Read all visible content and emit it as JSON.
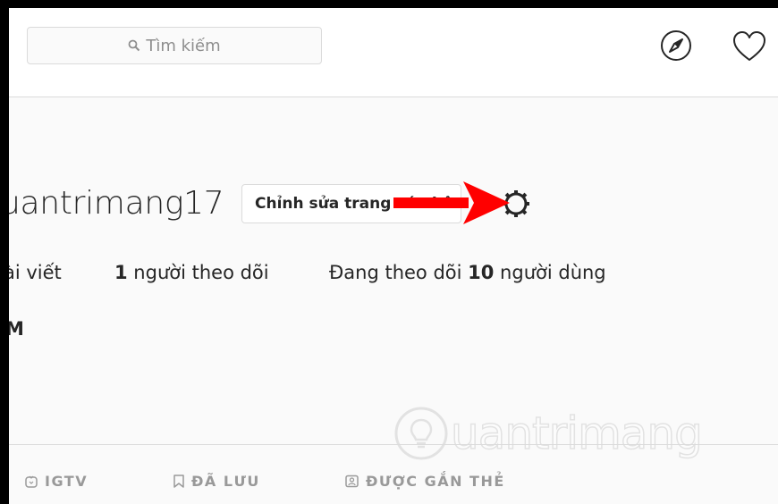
{
  "search": {
    "placeholder": "Tìm kiếm"
  },
  "header": {
    "icons": [
      "compass-icon",
      "heart-icon"
    ]
  },
  "profile": {
    "username": "uantrimang17",
    "edit_button": "Chỉnh sửa trang cá nhân",
    "stats": {
      "posts_label": "ài viết",
      "followers_count": "1",
      "followers_label": " người theo dõi",
      "following_prefix": "Đang theo dõi ",
      "following_count": "10",
      "following_suffix": " người dùng"
    },
    "full_name": "M"
  },
  "tabs": [
    {
      "label": "IGTV",
      "icon": "igtv-icon"
    },
    {
      "label": "ĐÃ LƯU",
      "icon": "bookmark-icon"
    },
    {
      "label": "ĐƯỢC GẮN THẺ",
      "icon": "tag-icon"
    }
  ],
  "watermark": {
    "text": "uantrimang"
  },
  "annotation": {
    "color": "#ff0000"
  }
}
